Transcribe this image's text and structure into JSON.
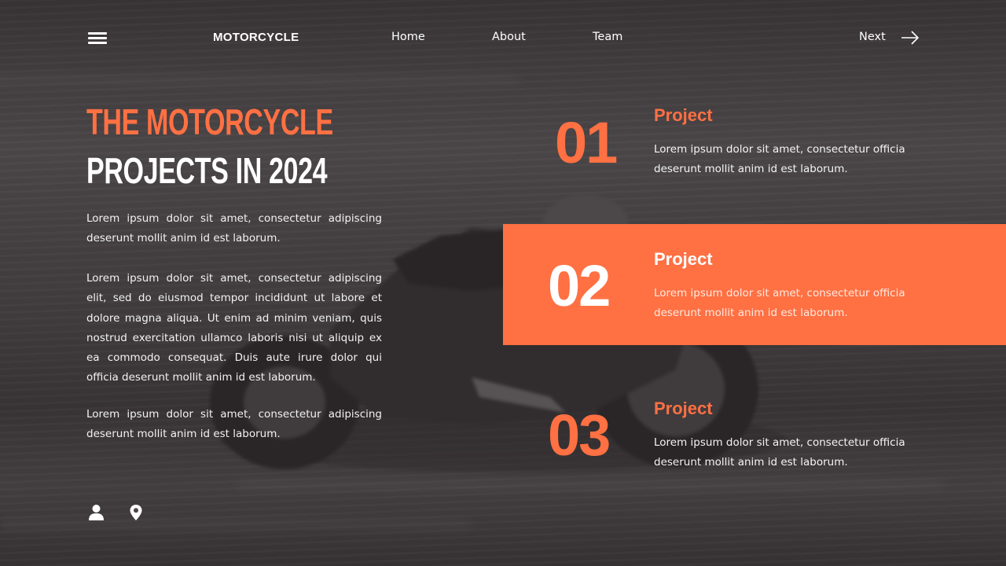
{
  "nav": {
    "brand": "MOTORCYCLE",
    "links": [
      "Home",
      "About",
      "Team"
    ],
    "next_label": "Next",
    "menu_icon": "hamburger-icon",
    "next_icon": "arrow-right-icon"
  },
  "hero": {
    "title_line1": "THE MOTORCYCLE",
    "title_line2": "PROJECTS IN 2024",
    "paragraphs": [
      "Lorem ipsum dolor sit amet, consectetur adipiscing deserunt mollit anim id est laborum.",
      "Lorem ipsum dolor sit amet, consectetur adipiscing elit, sed do eiusmod tempor incididunt ut labore et dolore magna aliqua. Ut enim ad minim veniam, quis nostrud exercitation ullamco laboris nisi ut aliquip ex ea commodo consequat. Duis aute irure dolor qui officia deserunt mollit anim id est laborum.",
      "Lorem ipsum dolor sit amet, consectetur adipiscing deserunt mollit anim id est laborum."
    ]
  },
  "projects": [
    {
      "number": "01",
      "title": "Project",
      "description": "Lorem ipsum dolor sit amet, consectetur officia deserunt mollit anim id est laborum.",
      "highlighted": false
    },
    {
      "number": "02",
      "title": "Project",
      "description": "Lorem ipsum dolor sit amet, consectetur officia deserunt mollit anim id est laborum.",
      "highlighted": true
    },
    {
      "number": "03",
      "title": "Project",
      "description": "Lorem ipsum dolor sit amet, consectetur officia deserunt mollit anim id est laborum.",
      "highlighted": false
    }
  ],
  "footer_icons": [
    "user-icon",
    "location-pin-icon"
  ],
  "colors": {
    "accent": "#ff7043",
    "text": "#ffffff",
    "background": "#4a4647"
  }
}
